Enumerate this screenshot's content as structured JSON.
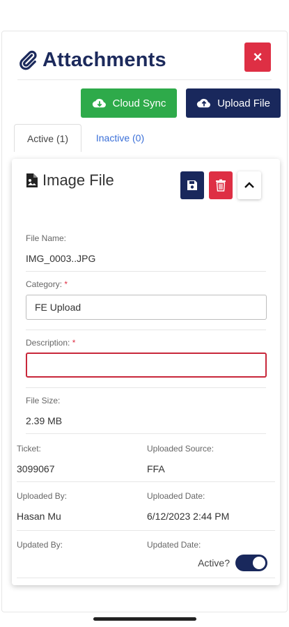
{
  "header": {
    "title": "Attachments",
    "close_symbol": "×"
  },
  "actions": {
    "cloud_sync_label": "Cloud Sync",
    "upload_file_label": "Upload File"
  },
  "tabs": [
    {
      "label": "Active (1)",
      "active": true
    },
    {
      "label": "Inactive (0)",
      "active": false
    }
  ],
  "card": {
    "title": "Image File",
    "file_name_label": "File Name:",
    "file_name": "IMG_0003..JPG",
    "category_label": "Category:",
    "category_value": "FE Upload",
    "description_label": "Description:",
    "description_value": "",
    "required_mark": "*",
    "file_size_label": "File Size:",
    "file_size": "2.39 MB",
    "ticket_label": "Ticket:",
    "ticket": "3099067",
    "uploaded_source_label": "Uploaded Source:",
    "uploaded_source": "FFA",
    "uploaded_by_label": "Uploaded By:",
    "uploaded_by": "Hasan Mu",
    "uploaded_date_label": "Uploaded Date:",
    "uploaded_date": "6/12/2023 2:44 PM",
    "updated_by_label": "Updated By:",
    "updated_by": "",
    "updated_date_label": "Updated Date:",
    "updated_date": "",
    "active_label": "Active?",
    "active": true
  },
  "colors": {
    "primary": "#19285c",
    "success": "#2eaa4a",
    "danger": "#de2f44",
    "link": "#3a6fd8"
  },
  "icons": [
    "paperclip-icon",
    "close-icon",
    "cloud-download-icon",
    "cloud-upload-icon",
    "image-file-icon",
    "save-icon",
    "trash-icon",
    "chevron-up-icon"
  ]
}
